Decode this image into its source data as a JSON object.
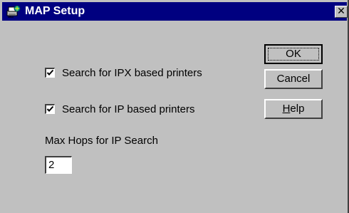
{
  "window": {
    "title": "MAP Setup",
    "app_icon": "printer-network-icon",
    "close_glyph": "✕"
  },
  "buttons": {
    "ok": {
      "prefix": "",
      "mnemonic": "",
      "suffix": "OK"
    },
    "cancel": "Cancel",
    "help": {
      "mnemonic": "H",
      "rest": "elp"
    }
  },
  "options": {
    "ipx": {
      "label": "Search for IPX based printers",
      "checked": true
    },
    "ip": {
      "label": "Search for IP based printers",
      "checked": true
    }
  },
  "hops": {
    "label": "Max Hops for IP Search",
    "value": "2"
  },
  "colors": {
    "titlebar": "#000080",
    "face": "#c0c0c0"
  }
}
